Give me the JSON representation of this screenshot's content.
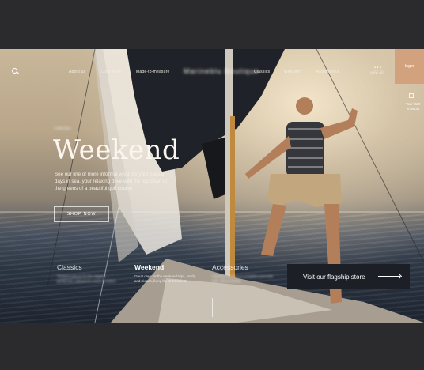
{
  "nav": {
    "links": [
      "About us",
      "Look Book",
      "Made-to-measure",
      "Classics",
      "Weekend",
      "Accessories"
    ],
    "blurred_brand": "Marineblu Boutique",
    "view_all": "view all",
    "login": "login",
    "cart": "Your Cart\nis empty"
  },
  "hero": {
    "kicker": "Collection",
    "title": "Weekend",
    "description": "See our line of more informal wear, for your casual days in sea, your relaxing drive with the top down or the greens of a beautiful golf course.",
    "cta": "SHOP NOW"
  },
  "categories": [
    {
      "title": "Classics",
      "desc": "Timeless pieces for the elegant gentleman, tailored for every occasion."
    },
    {
      "title": "Weekend",
      "desc": "Great days for the weekend trips, family and friends, living life at it's fullest."
    },
    {
      "title": "Accessories",
      "desc": "Finishing touches to complete your look with refined details."
    }
  ],
  "flagship": "Visit our flagship store",
  "colors": {
    "accent": "#d2a27e",
    "dark": "#1c1f25"
  }
}
